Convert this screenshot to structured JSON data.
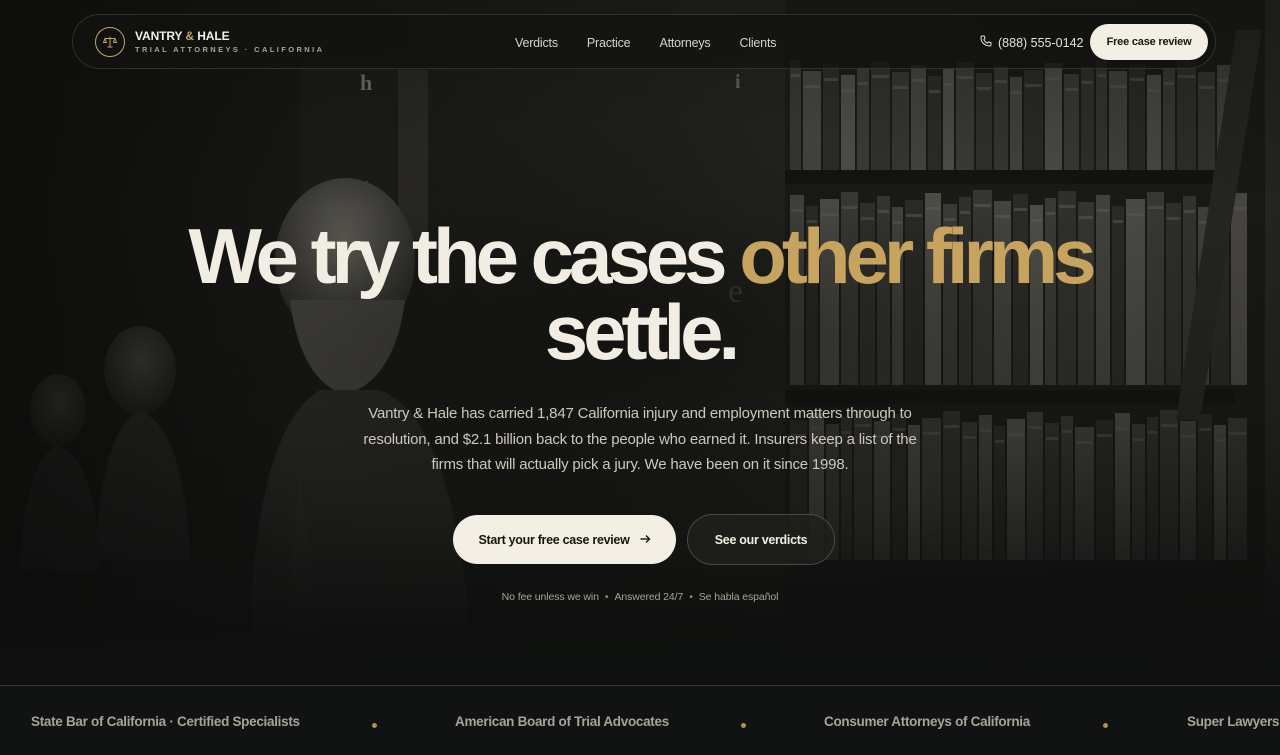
{
  "brand": {
    "name_part1": "VANTRY",
    "name_amp": "&",
    "name_part2": "HALE",
    "tagline": "TRIAL ATTORNEYS · CALIFORNIA",
    "logo_icon": "scales-icon"
  },
  "nav": {
    "links": [
      "Verdicts",
      "Practice",
      "Attorneys",
      "Clients"
    ],
    "phone_icon": "phone-icon",
    "phone": "(888) 555-0142",
    "cta": "Free case review"
  },
  "hero": {
    "title_main": "We try the cases",
    "title_accent": "other firms",
    "title_end": "settle.",
    "subtitle": "Vantry & Hale has carried 1,847 California injury and employment matters through to resolution, and $2.1 billion back to the people who earned it. Insurers keep a list of the firms that will actually pick a jury. We have been on it since 1998.",
    "primary_cta": "Start your free case review",
    "primary_cta_icon": "arrow-right-icon",
    "secondary_cta": "See our verdicts",
    "assurances": [
      "No fee unless we win",
      "Answered 24/7",
      "Se habla español"
    ]
  },
  "credentials": [
    "State Bar of California · Certified Specialists",
    "American Board of Trial Advocates",
    "Consumer Attorneys of California",
    "Super Lawyers"
  ],
  "colors": {
    "accent_gold": "#c6a35e",
    "cream": "#f4efe4",
    "background": "#0d0e0c"
  }
}
